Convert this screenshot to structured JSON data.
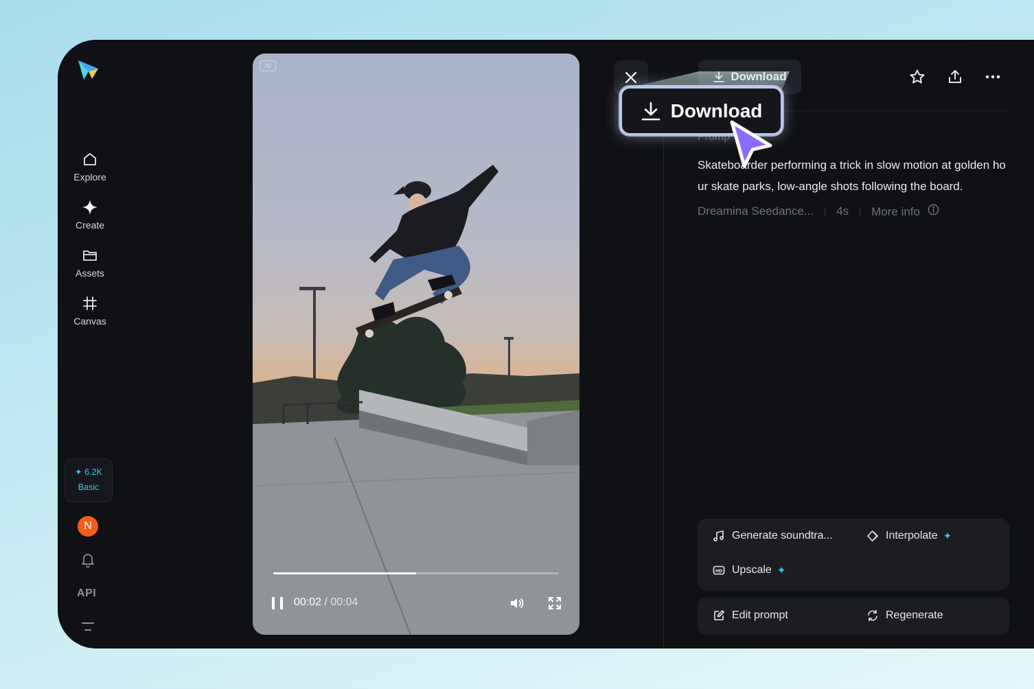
{
  "sidebar": {
    "logo": "dreamina-logo",
    "items": [
      {
        "label": "Explore",
        "icon": "home-icon"
      },
      {
        "label": "Create",
        "icon": "sparkle-icon"
      },
      {
        "label": "Assets",
        "icon": "folder-icon"
      },
      {
        "label": "Canvas",
        "icon": "canvas-icon"
      }
    ],
    "credits": {
      "amount": "6.2K",
      "plan": "Basic"
    },
    "avatar_letter": "N",
    "api_label": "API"
  },
  "video": {
    "badge": "AI",
    "current_time": "00:02",
    "separator": " / ",
    "duration": "00:04",
    "progress": 0.5
  },
  "panel": {
    "download_label": "Download",
    "prompt_label": "Promp",
    "prompt_text": "Skateboarder performing a trick in slow motion at golden hour skate parks, low-angle shots following the board.",
    "model": "Dreamina Seedance...",
    "length": "4s",
    "more_info": "More info",
    "actions": {
      "soundtrack": "Generate soundtra...",
      "interpolate": "Interpolate",
      "upscale": "Upscale",
      "edit_prompt": "Edit prompt",
      "regenerate": "Regenerate"
    }
  },
  "callout": {
    "label": "Download"
  },
  "colors": {
    "accent": "#33c6ec",
    "avatar": "#f25d17",
    "callout_border": "#b9c9ff",
    "cursor": "#8b6cff"
  }
}
